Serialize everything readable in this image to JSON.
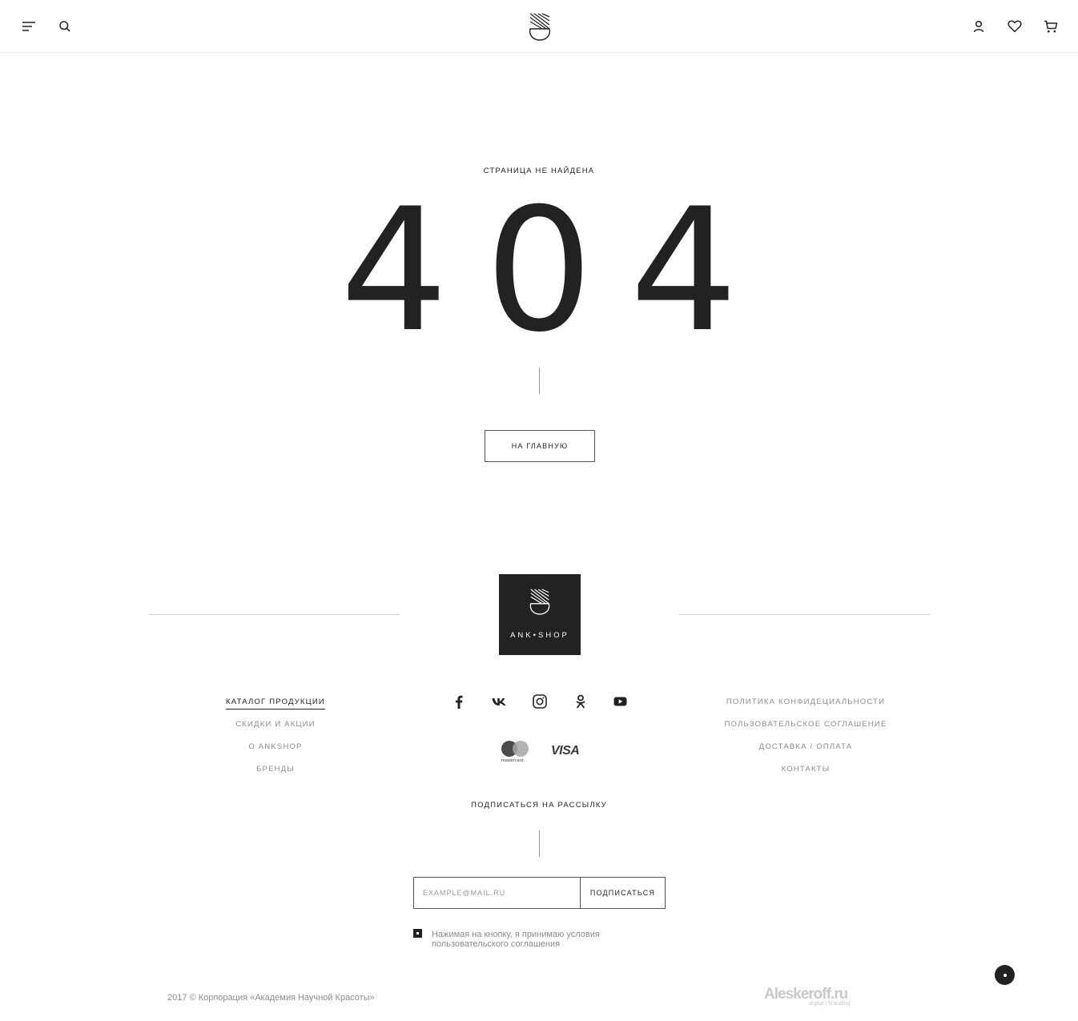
{
  "header": {
    "menu_icon": "hamburger-icon",
    "search_icon": "search-icon",
    "logo": "brand-logo",
    "account_icon": "user-icon",
    "wishlist_icon": "heart-icon",
    "cart_icon": "cart-icon"
  },
  "error": {
    "label": "СТРАНИЦА НЕ НАЙДЕНА",
    "code": "404",
    "home_button": "НА ГЛАВНУЮ"
  },
  "footer": {
    "brand_text": "ANK•SHOP",
    "nav_left": [
      {
        "label": "КАТАЛОГ ПРОДУКЦИИ",
        "active": true
      },
      {
        "label": "СКИДКИ И АКЦИИ"
      },
      {
        "label": "О ANKSHOP"
      },
      {
        "label": "БРЕНДЫ"
      }
    ],
    "nav_right": [
      {
        "label": "ПОЛИТИКА КОНФИДЕЦИАЛЬНОСТИ"
      },
      {
        "label": "ПОЛЬЗОВАТЕЛЬСКОЕ СОГЛАШЕНИЕ"
      },
      {
        "label": "ДОСТАВКА / ОПЛАТА"
      },
      {
        "label": "КОНТАКТЫ"
      }
    ],
    "social": [
      "facebook-icon",
      "vk-icon",
      "instagram-icon",
      "odnoklassniki-icon",
      "youtube-icon"
    ],
    "payments": {
      "mastercard": "mastercard",
      "visa": "VISA"
    },
    "subscribe": {
      "title": "ПОДПИСАТЬСЯ НА РАССЫЛКУ",
      "email_placeholder": "EXAMPLE@MAIL.RU",
      "email_value": "",
      "button": "ПОДПИСАТЬСЯ",
      "agreement": "Нажимая на кнопку, я принимаю условия пользовательского соглашения",
      "agreement_checked": true
    },
    "copyright": "2017 © Корпорация «Академия Научной Красоты»",
    "developer": {
      "name": "Aleskeroff.ru",
      "tagline": "digital | branding"
    }
  },
  "colors": {
    "text": "#222222",
    "muted": "#8c8c8c",
    "line": "#cfcfcf",
    "brand_block": "#222222",
    "background": "#ffffff"
  }
}
